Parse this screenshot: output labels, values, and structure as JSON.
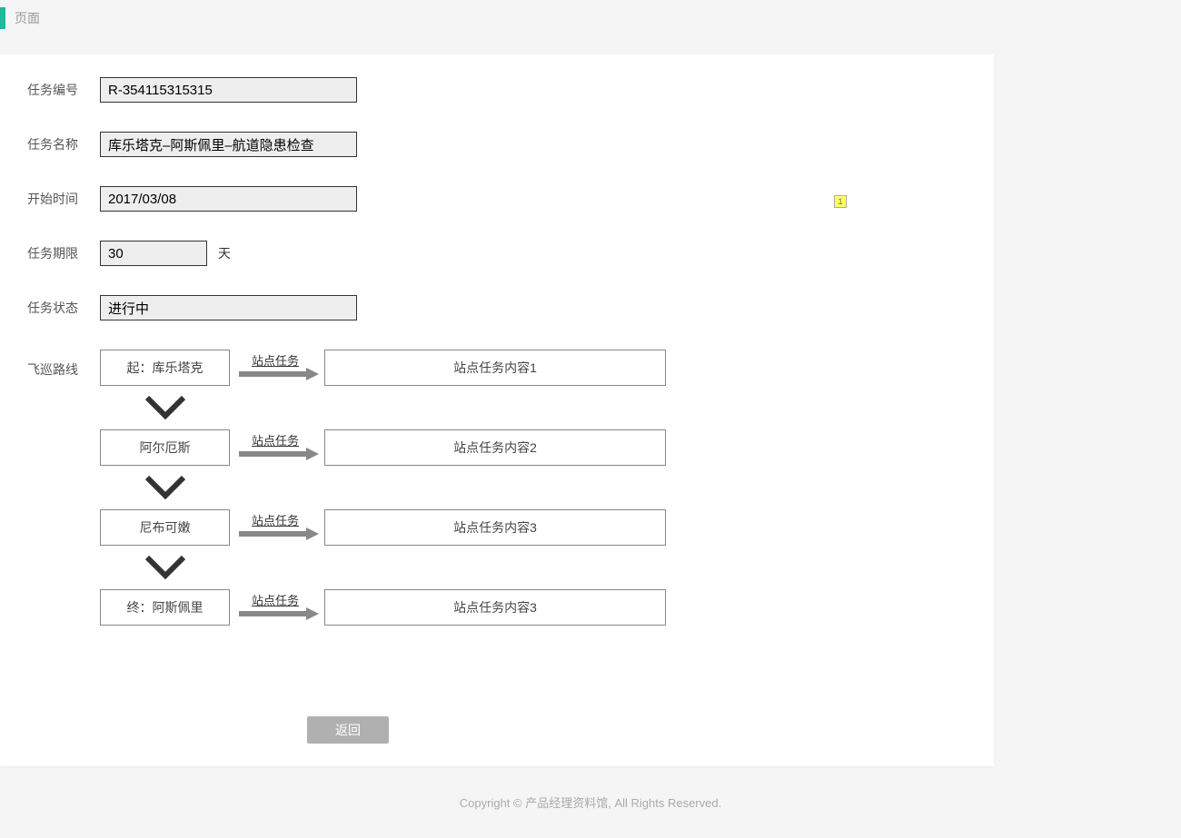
{
  "header": {
    "title": "页面"
  },
  "form": {
    "taskIdLabel": "任务编号",
    "taskIdValue": "R-354115315315",
    "taskNameLabel": "任务名称",
    "taskNameValue": "库乐塔克–阿斯佩里–航道隐患检查",
    "startTimeLabel": "开始时间",
    "startTimeValue": "2017/03/08",
    "durationLabel": "任务期限",
    "durationValue": "30",
    "durationUnit": "天",
    "statusLabel": "任务状态",
    "statusValue": "进行中"
  },
  "route": {
    "label": "飞巡路线",
    "linkText": "站点任务",
    "stops": [
      {
        "station": "起：库乐塔克",
        "content": "站点任务内容1"
      },
      {
        "station": "阿尔厄斯",
        "content": "站点任务内容2"
      },
      {
        "station": "尼布可嫩",
        "content": "站点任务内容3"
      },
      {
        "station": "终：阿斯佩里",
        "content": "站点任务内容3"
      }
    ]
  },
  "backButton": "返回",
  "footer": "Copyright © 产品经理资料馆, All Rights Reserved.",
  "noteBadge": "1"
}
